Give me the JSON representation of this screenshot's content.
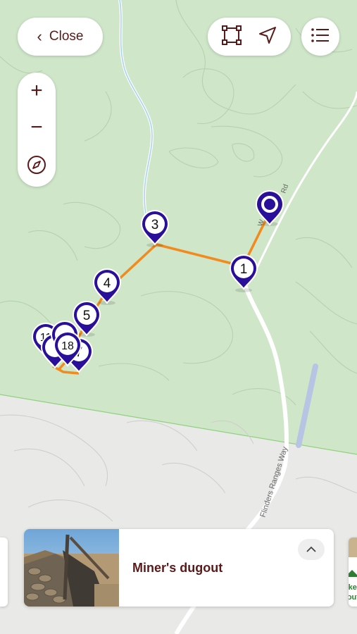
{
  "topbar": {
    "close_label": "Close",
    "area_tool_icon": "square-selection-icon",
    "locate_icon": "navigation-arrow-icon",
    "menu_icon": "list-icon"
  },
  "zoom": {
    "zoom_in": "+",
    "zoom_out": "−",
    "compass_icon": "compass-icon"
  },
  "map": {
    "road_labels": [
      "Flinders Ranges Way",
      "Rd",
      "W"
    ],
    "markers": [
      {
        "label": "1"
      },
      {
        "label": "3"
      },
      {
        "label": "4"
      },
      {
        "label": "5"
      },
      {
        "label": "11"
      },
      {
        "label": "18"
      },
      {
        "label": "7"
      }
    ],
    "colors": {
      "marker": "#2a0f9a",
      "route": "#f28a1d",
      "green": "#c9e3c4",
      "park_edge": "#8fd27d"
    }
  },
  "card": {
    "title": "Miner's dugout",
    "collapse_icon": "chevron-up-icon"
  },
  "edge_card_right": {
    "text_lines": [
      "kes",
      "out,"
    ]
  }
}
